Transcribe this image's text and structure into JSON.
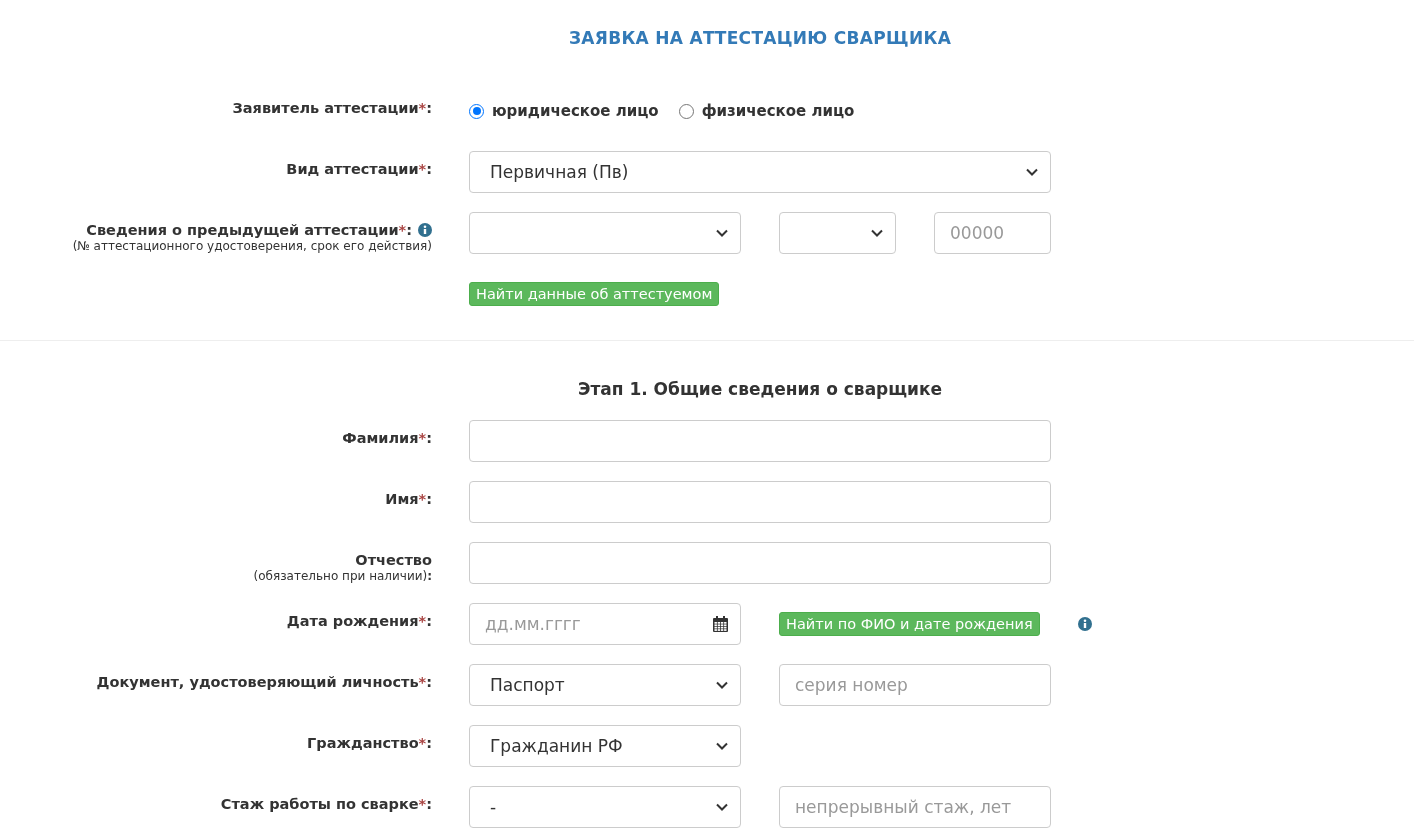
{
  "title": "ЗАЯВКА НА АТТЕСТАЦИЮ СВАРЩИКА",
  "section1": [
    {
      "label": "Заявитель аттестации",
      "mark": "*",
      "colon": ":",
      "controls": [
        {
          "kind": "radio",
          "options": [
            {
              "label": "юридическое лицо",
              "selected": true
            },
            {
              "label": "физическое лицо",
              "selected": false
            }
          ]
        }
      ]
    },
    {
      "label": "Вид аттестации",
      "mark": "*",
      "colon": ":",
      "controls": [
        {
          "kind": "select",
          "value": "Первичная (Пв)"
        }
      ]
    },
    {
      "label": "Сведения о предыдущей аттестации",
      "mark": "*",
      "colon": ":",
      "info": true,
      "hint": "(№ аттестационного удостоверения, срок его действия)",
      "controls": [
        {
          "kind": "select"
        },
        {
          "kind": "select"
        },
        {
          "kind": "input",
          "placeholder": "00000"
        }
      ]
    },
    {
      "controls": [
        {
          "kind": "button",
          "label": "Найти данные об аттестуемом"
        }
      ]
    }
  ],
  "section2_heading": "Этап 1. Общие сведения о сварщике",
  "section2": [
    {
      "label": "Фамилия",
      "mark": "*",
      "colon": ":",
      "controls": [
        {
          "kind": "input"
        }
      ]
    },
    {
      "label": "Имя",
      "mark": "*",
      "colon": ":",
      "controls": [
        {
          "kind": "input"
        }
      ]
    },
    {
      "label": "Отчество",
      "hint": "(обязательно при наличии)**:**",
      "controls": [
        {
          "kind": "input"
        }
      ]
    },
    {
      "label": "Дата рождения",
      "mark": "*",
      "colon": ":",
      "controls": [
        {
          "kind": "date",
          "placeholder": "дд.мм.гггг"
        },
        {
          "kind": "button",
          "label": "Найти по ФИО и дате рождения"
        },
        {
          "kind": "info"
        }
      ]
    },
    {
      "label": "Документ, удостоверяющий личность",
      "mark": "*",
      "colon": ":",
      "controls": [
        {
          "kind": "select",
          "value": "Паспорт"
        },
        {
          "kind": "input",
          "placeholder": "серия номер"
        }
      ]
    },
    {
      "label": "Гражданство",
      "mark": "*",
      "colon": ":",
      "controls": [
        {
          "kind": "select",
          "value": "Гражданин РФ"
        }
      ]
    },
    {
      "label": "Стаж работы по сварке",
      "mark": "*",
      "colon": ":",
      "controls": [
        {
          "kind": "select",
          "value": "-"
        },
        {
          "kind": "input",
          "placeholder": "непрерывный стаж, лет"
        }
      ]
    }
  ]
}
